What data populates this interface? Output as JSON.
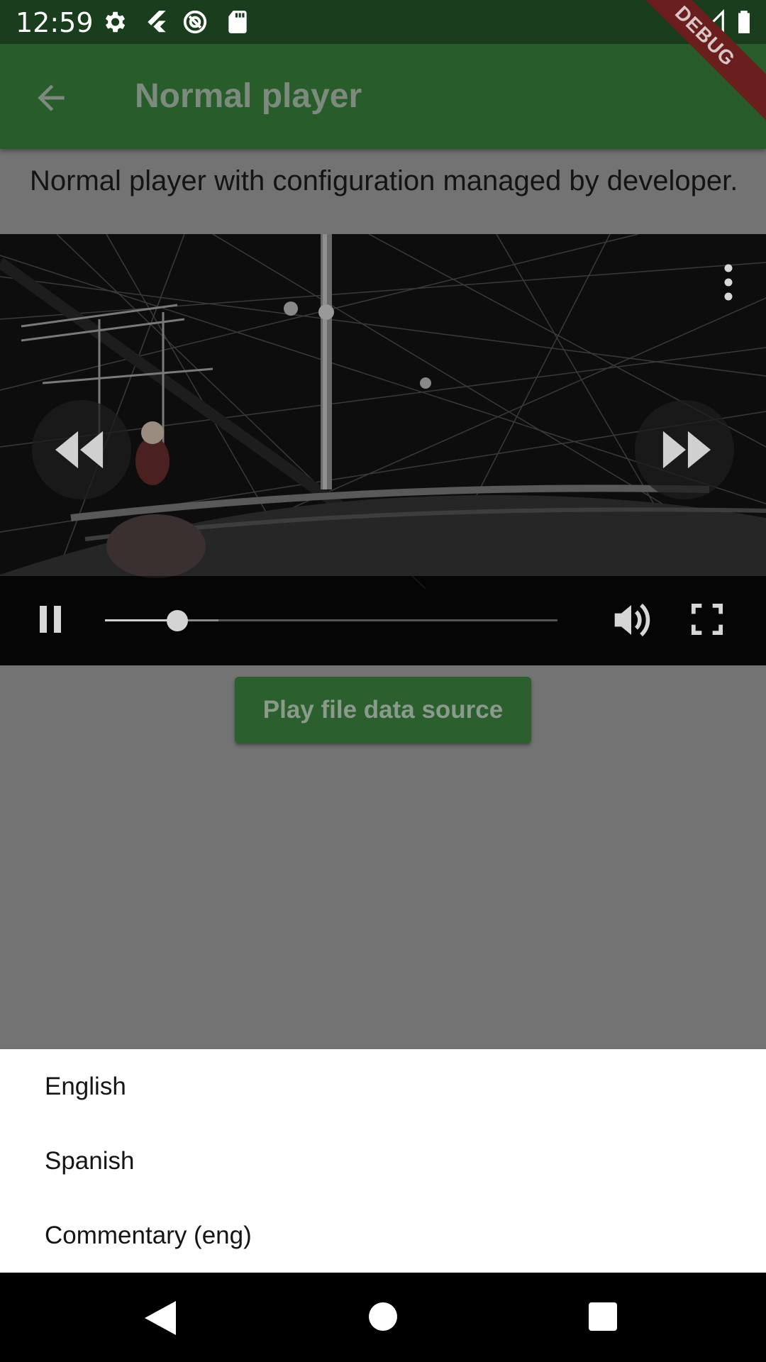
{
  "status_bar": {
    "time": "12:59",
    "left_icons": [
      "settings-icon",
      "flutter-icon",
      "vpn-icon",
      "sd-card-icon"
    ],
    "right_icons": [
      "wifi-icon",
      "signal-icon",
      "battery-icon"
    ]
  },
  "debug_banner": {
    "label": "DEBUG"
  },
  "app_bar": {
    "title": "Normal player",
    "back_icon": "arrow-back-icon"
  },
  "description": "Normal player with configuration managed by developer.",
  "player": {
    "progress_fraction": 0.16,
    "buffered_fraction": 0.25,
    "controls": [
      "pause-icon",
      "volume-icon",
      "fullscreen-icon",
      "more-vert-icon",
      "rewind-icon",
      "fast-forward-icon"
    ]
  },
  "play_file_button": {
    "label": "Play file data source"
  },
  "audio_track_sheet": {
    "items": [
      {
        "label": "English"
      },
      {
        "label": "Spanish"
      },
      {
        "label": "Commentary (eng)"
      }
    ]
  },
  "nav_bar": {
    "icons": [
      "nav-back-icon",
      "nav-home-icon",
      "nav-recents-icon"
    ]
  },
  "colors": {
    "app_bar": "#285d2b",
    "status_bar": "#1a3d1e",
    "scrim_background": "#737373",
    "button": "#2b602e",
    "debug_ribbon": "#6b1e1e"
  }
}
